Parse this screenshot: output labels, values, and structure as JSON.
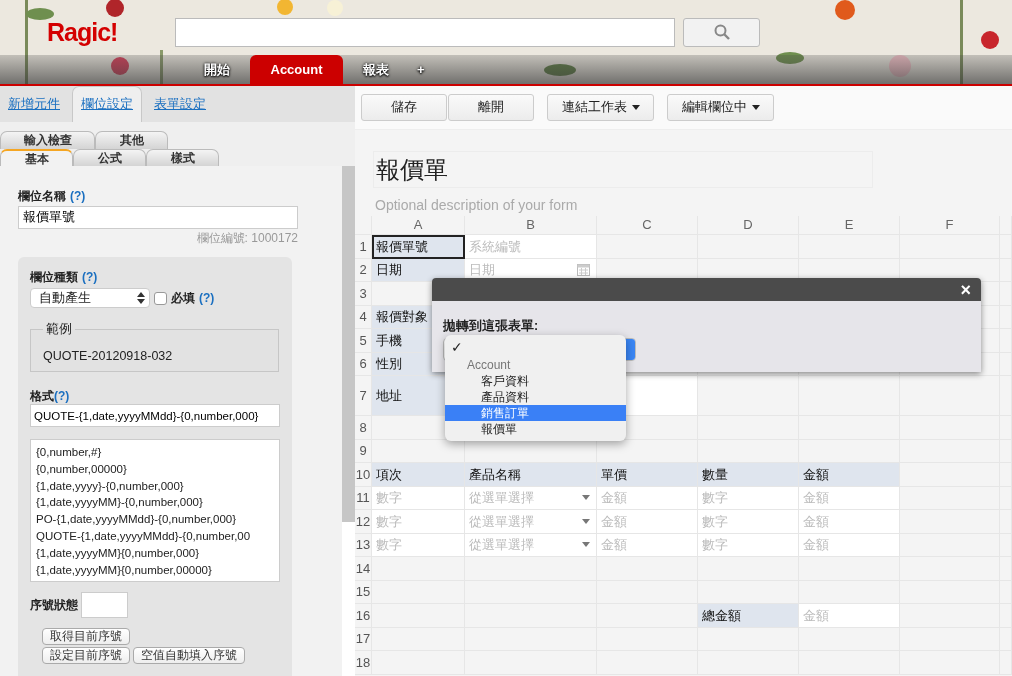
{
  "header": {
    "logo": "Ragic!",
    "nav_tabs": [
      {
        "label": "開始",
        "selected": false
      },
      {
        "label": "Account",
        "selected": true
      },
      {
        "label": "報表",
        "selected": false
      },
      {
        "label": "+",
        "selected": false
      }
    ]
  },
  "left_panel": {
    "tabs": [
      {
        "label": "新增元件",
        "selected": false
      },
      {
        "label": "欄位設定",
        "selected": true
      },
      {
        "label": "表單設定",
        "selected": false
      }
    ],
    "subtab_rows": [
      {
        "tabs": [
          {
            "label": "輸入檢查",
            "selected": false
          },
          {
            "label": "其他",
            "selected": false
          }
        ]
      },
      {
        "tabs": [
          {
            "label": "基本",
            "selected": true
          },
          {
            "label": "公式",
            "selected": false
          },
          {
            "label": "樣式",
            "selected": false
          }
        ]
      }
    ],
    "field_name": {
      "label": "欄位名稱",
      "help": "(?)",
      "value": "報價單號"
    },
    "field_id": "欄位編號: 1000172",
    "field_type": {
      "label": "欄位種類",
      "help": "(?)",
      "value": "自動產生"
    },
    "required": {
      "label": "必填",
      "help": "(?)",
      "checked": false
    },
    "example": {
      "legend": "範例",
      "value": "QUOTE-20120918-032"
    },
    "format": {
      "label": "格式",
      "help": "(?)",
      "value": "QUOTE-{1,date,yyyyMMdd}-{0,number,000}",
      "presets": [
        "{0,number,#}",
        "{0,number,00000}",
        "{1,date,yyyy}-{0,number,000}",
        "{1,date,yyyyMM}-{0,number,000}",
        "PO-{1,date,yyyyMMdd}-{0,number,000}",
        "QUOTE-{1,date,yyyyMMdd}-{0,number,00",
        "{1,date,yyyyMM}{0,number,000}",
        "{1,date,yyyyMM}{0,number,00000}"
      ]
    },
    "serial_status": {
      "label": "序號狀態"
    },
    "button_rows": [
      {
        "buttons": [
          "取得目前序號"
        ]
      },
      {
        "buttons": [
          "設定目前序號",
          "空值自動填入序號"
        ]
      }
    ]
  },
  "toolbar": {
    "button_groups": [
      {
        "buttons": [
          {
            "label": "儲存",
            "dropdown": false
          },
          {
            "label": "離開",
            "dropdown": false
          }
        ]
      },
      {
        "buttons": [
          {
            "label": "連結工作表",
            "dropdown": true
          }
        ]
      },
      {
        "buttons": [
          {
            "label": "編輯欄位中",
            "dropdown": true
          }
        ]
      }
    ]
  },
  "sheet": {
    "title": "報價單",
    "description_placeholder": "Optional description of your form",
    "columns": [
      "A",
      "B",
      "C",
      "D",
      "E",
      "F"
    ],
    "rows": [
      {
        "number": "1",
        "tall": false,
        "cells": [
          {
            "kind": "label",
            "text": "報價單號",
            "selected": true
          },
          {
            "kind": "text",
            "text": "系統編號",
            "selected": false
          }
        ]
      },
      {
        "number": "2",
        "tall": false,
        "cells": [
          {
            "kind": "label",
            "text": "日期",
            "selected": false
          },
          {
            "kind": "date",
            "text": "日期",
            "selected": false
          }
        ]
      },
      {
        "number": "3",
        "tall": false
      },
      {
        "number": "4",
        "tall": false,
        "cells": [
          {
            "kind": "label",
            "text": "報價對象",
            "selected": false
          }
        ]
      },
      {
        "number": "5",
        "tall": false,
        "cells": [
          {
            "kind": "label",
            "text": "手機",
            "selected": false
          }
        ]
      },
      {
        "number": "6",
        "tall": false,
        "cells": [
          {
            "kind": "label",
            "text": "性別",
            "selected": false
          }
        ]
      },
      {
        "number": "7",
        "tall": true,
        "cells": [
          {
            "kind": "label",
            "text": "地址",
            "selected": false
          },
          {
            "kind": "field",
            "merged": true,
            "selected": false
          }
        ]
      },
      {
        "number": "8",
        "tall": false
      },
      {
        "number": "9",
        "tall": false
      },
      {
        "number": "10",
        "tall": false,
        "cells": [
          {
            "kind": "label",
            "text": "項次",
            "selected": false
          },
          {
            "kind": "label",
            "text": "產品名稱",
            "selected": false
          },
          {
            "kind": "label",
            "text": "單價",
            "selected": false
          },
          {
            "kind": "label",
            "text": "數量",
            "selected": false
          },
          {
            "kind": "label",
            "text": "金額",
            "selected": false
          }
        ]
      },
      {
        "number": "11",
        "tall": false,
        "cells": [
          {
            "kind": "text",
            "text": "數字",
            "selected": false
          },
          {
            "kind": "select",
            "text": "從選單選擇",
            "selected": false
          },
          {
            "kind": "text",
            "text": "金額",
            "selected": false
          },
          {
            "kind": "text",
            "text": "數字",
            "selected": false
          },
          {
            "kind": "text",
            "text": "金額",
            "selected": false
          }
        ]
      },
      {
        "number": "12",
        "tall": false,
        "cells": [
          {
            "kind": "text",
            "text": "數字",
            "selected": false
          },
          {
            "kind": "select",
            "text": "從選單選擇",
            "selected": false
          },
          {
            "kind": "text",
            "text": "金額",
            "selected": false
          },
          {
            "kind": "text",
            "text": "數字",
            "selected": false
          },
          {
            "kind": "text",
            "text": "金額",
            "selected": false
          }
        ]
      },
      {
        "number": "13",
        "tall": false,
        "cells": [
          {
            "kind": "text",
            "text": "數字",
            "selected": false
          },
          {
            "kind": "select",
            "text": "從選單選擇",
            "selected": false
          },
          {
            "kind": "text",
            "text": "金額",
            "selected": false
          },
          {
            "kind": "text",
            "text": "數字",
            "selected": false
          },
          {
            "kind": "text",
            "text": "金額",
            "selected": false
          }
        ]
      },
      {
        "number": "14",
        "tall": false
      },
      {
        "number": "15",
        "tall": false
      },
      {
        "number": "16",
        "tall": false,
        "cells": [
          {
            "kind": "blank"
          },
          {
            "kind": "blank"
          },
          {
            "kind": "blank"
          },
          {
            "kind": "label",
            "text": "總金額",
            "selected": false
          },
          {
            "kind": "text",
            "text": "金額",
            "selected": false
          }
        ]
      },
      {
        "number": "17",
        "tall": false
      },
      {
        "number": "18",
        "tall": false
      }
    ]
  },
  "dialog": {
    "close": "×",
    "label": "拋轉到這張表單:",
    "menu": [
      {
        "kind": "current",
        "mark": "✓"
      },
      {
        "kind": "group",
        "label": "Account"
      },
      {
        "kind": "option",
        "label": "客戶資料",
        "selected": false
      },
      {
        "kind": "option",
        "label": "產品資料",
        "selected": false
      },
      {
        "kind": "option",
        "label": "銷售訂單",
        "selected": true
      },
      {
        "kind": "option",
        "label": "報價單",
        "selected": false
      }
    ]
  }
}
